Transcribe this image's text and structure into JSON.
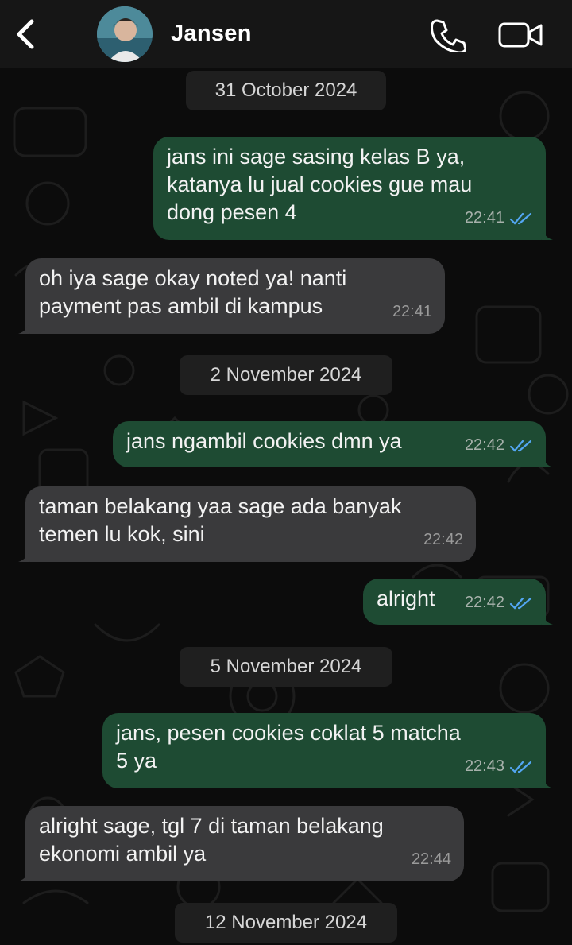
{
  "header": {
    "contact_name": "Jansen",
    "icons": [
      "chevron-left-icon",
      "avatar",
      "phone-icon",
      "video-camera-icon"
    ]
  },
  "colors": {
    "background": "#0c0c0c",
    "header_bg": "#161616",
    "outgoing_bubble": "#1e4b33",
    "incoming_bubble": "#3a3a3c",
    "read_ticks": "#53a6f2",
    "date_pill": "#1f1f1f"
  },
  "messages": {
    "date1": "31 October 2024",
    "m1": {
      "text": "jans ini sage sasing kelas B ya,\nkatanya lu jual cookies gue mau\ndong pesen 4",
      "time": "22:41",
      "direction": "outgoing",
      "status": "read"
    },
    "m2": {
      "text": "oh iya sage okay noted ya! nanti\npayment pas ambil di kampus",
      "time": "22:41",
      "direction": "incoming"
    },
    "date2": "2 November 2024",
    "m3": {
      "text": "jans ngambil cookies dmn ya",
      "time": "22:42",
      "direction": "outgoing",
      "status": "read"
    },
    "m4": {
      "text": "taman belakang yaa sage ada banyak\ntemen lu kok, sini",
      "time": "22:42",
      "direction": "incoming"
    },
    "m5": {
      "text": "alright",
      "time": "22:42",
      "direction": "outgoing",
      "status": "read"
    },
    "date3": "5 November 2024",
    "m6": {
      "text": "jans, pesen cookies coklat 5 matcha\n5 ya",
      "time": "22:43",
      "direction": "outgoing",
      "status": "read"
    },
    "m7": {
      "text": "alright sage, tgl 7 di taman belakang\nekonomi ambil ya",
      "time": "22:44",
      "direction": "incoming"
    },
    "date4": "12 November 2024"
  }
}
